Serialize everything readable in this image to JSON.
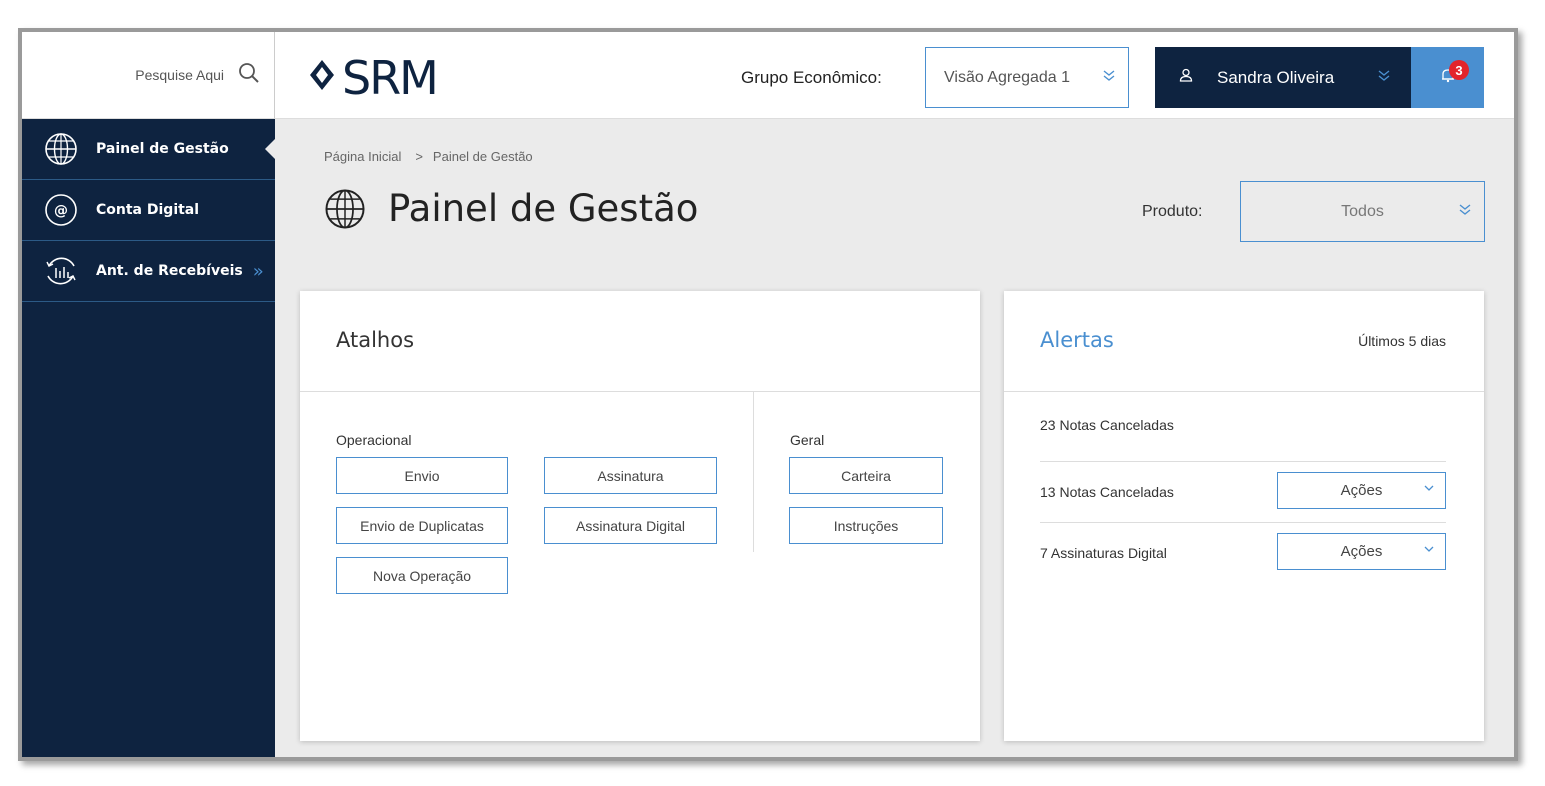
{
  "search": {
    "placeholder": "Pesquise Aqui"
  },
  "sidebar": {
    "items": [
      {
        "label": "Painel de Gestão",
        "icon": "globe-icon",
        "active": true
      },
      {
        "label": "Conta Digital",
        "icon": "at-icon",
        "active": false
      },
      {
        "label": "Ant. de Recebíveis",
        "icon": "chart-cycle-icon",
        "active": false,
        "chevron": "»"
      }
    ]
  },
  "header": {
    "logo_text": "SRM",
    "grupo_label": "Grupo Econômico:",
    "grupo_value": "Visão Agregada 1",
    "user_name": "Sandra Oliveira",
    "notification_count": "3"
  },
  "breadcrumb": {
    "home": "Página Inicial",
    "separator": ">",
    "current": "Painel de Gestão"
  },
  "page": {
    "title": "Painel de Gestão",
    "produto_label": "Produto:",
    "produto_value": "Todos"
  },
  "atalhos": {
    "title": "Atalhos",
    "operacional_label": "Operacional",
    "geral_label": "Geral",
    "operacional": [
      "Envio",
      "Assinatura",
      "Envio de Duplicatas",
      "Assinatura Digital",
      "Nova Operação"
    ],
    "geral": [
      "Carteira",
      "Instruções"
    ]
  },
  "alertas": {
    "title": "Alertas",
    "period": "Últimos 5 dias",
    "rows": [
      {
        "text": "23 Notas Canceladas"
      },
      {
        "text": "13 Notas Canceladas",
        "action": "Ações"
      },
      {
        "text": "7 Assinaturas Digital",
        "action": "Ações"
      }
    ]
  },
  "colors": {
    "navy": "#0e2340",
    "accent": "#4a8fd0",
    "badge": "#e3242b"
  }
}
